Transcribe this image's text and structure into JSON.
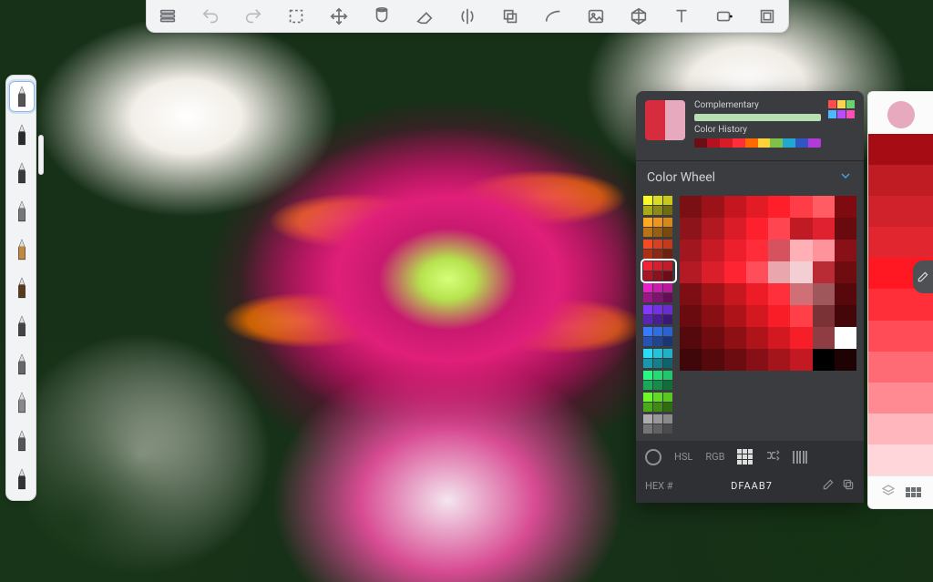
{
  "topbar": {
    "items": [
      {
        "name": "layers-icon",
        "interact": true
      },
      {
        "name": "undo-icon",
        "interact": true,
        "dim": true
      },
      {
        "name": "redo-icon",
        "interact": true,
        "dim": true
      },
      {
        "name": "selection-tool-icon",
        "interact": true
      },
      {
        "name": "transform-move-icon",
        "interact": true
      },
      {
        "name": "fill-bucket-icon",
        "interact": true
      },
      {
        "name": "eraser-icon",
        "interact": true
      },
      {
        "name": "symmetry-icon",
        "interact": true
      },
      {
        "name": "predictive-stroke-icon",
        "interact": true
      },
      {
        "name": "curve-ruler-icon",
        "interact": true
      },
      {
        "name": "import-image-icon",
        "interact": true
      },
      {
        "name": "perspective-grid-icon",
        "interact": true
      },
      {
        "name": "text-tool-icon",
        "interact": true
      },
      {
        "name": "timelapse-icon",
        "interact": true
      },
      {
        "name": "fullscreen-icon",
        "interact": true
      }
    ]
  },
  "left_tools": {
    "items": [
      {
        "name": "pencil-tool",
        "selected": true
      },
      {
        "name": "pen-tool"
      },
      {
        "name": "pen-fine-tool"
      },
      {
        "name": "marker-tool"
      },
      {
        "name": "brush-pen-tool"
      },
      {
        "name": "brush-broad-tool"
      },
      {
        "name": "airbrush-tool"
      },
      {
        "name": "smudge-tool"
      },
      {
        "name": "flat-brush-tool"
      },
      {
        "name": "chisel-tool"
      },
      {
        "name": "marker-chisel-tool"
      }
    ]
  },
  "color_panel": {
    "current_a": "#d72c3e",
    "current_b": "#e6a9bd",
    "complementary_label": "Complementary",
    "complementary_color": "#b7dfb1",
    "history_label": "Color History",
    "history": [
      "#6a0f15",
      "#b51220",
      "#d61c29",
      "#ff2e3b",
      "#ff6a00",
      "#ffd23a",
      "#7fc24b",
      "#22a7d0",
      "#3255c4",
      "#b13bd6"
    ],
    "mini": [
      [
        "#ff4d4d",
        "#ffd24d",
        "#6bd36b"
      ],
      [
        "#4db8ff",
        "#b84dff",
        "#ff4db8"
      ]
    ],
    "heading": "Color Wheel",
    "palette_groups": [
      {
        "base": "#c7c71f"
      },
      {
        "base": "#d8871a"
      },
      {
        "base": "#c63a1a"
      },
      {
        "base": "#c41a2a",
        "selected": true
      },
      {
        "base": "#b81a9e"
      },
      {
        "base": "#6a2bd1"
      },
      {
        "base": "#2b62d1"
      },
      {
        "base": "#1fb2c7"
      },
      {
        "base": "#1fc76a"
      },
      {
        "base": "#58c71f"
      },
      {
        "base": "#8a8a8a"
      }
    ],
    "big_grid": [
      "#7a0f14",
      "#9c1219",
      "#c4161f",
      "#e31b25",
      "#ff1f2a",
      "#ff3d46",
      "#ff5c64",
      "#7f0b10",
      "#8e141c",
      "#b11822",
      "#d91c28",
      "#ff202e",
      "#ff4550",
      "#c01b24",
      "#e02230",
      "#690a0e",
      "#a2161f",
      "#c81a26",
      "#ee1f2d",
      "#ff2c3a",
      "#d6525e",
      "#ffb0b6",
      "#ff939b",
      "#8a1017",
      "#b41a24",
      "#da1f2b",
      "#ff2432",
      "#ff4d59",
      "#e9a6ac",
      "#f3ced2",
      "#b92b35",
      "#6f0c10",
      "#7d0f14",
      "#9f1319",
      "#c7171f",
      "#ed1c26",
      "#ff303c",
      "#cf7076",
      "#a0575c",
      "#57080b",
      "#690b0f",
      "#8a0f14",
      "#ae131a",
      "#d41820",
      "#f81d27",
      "#ff4049",
      "#7a3236",
      "#440609",
      "#55090c",
      "#700c10",
      "#8e1015",
      "#af141b",
      "#d21922",
      "#f51e29",
      "#8f3d42",
      "#ffffff",
      "#40070a",
      "#55090c",
      "#6c0c10",
      "#861015",
      "#a3141b",
      "#c41822",
      "#000000",
      "#1e0304"
    ],
    "modes": {
      "hsl": "HSL",
      "rgb": "RGB"
    },
    "hex_label": "HEX #",
    "hex_value": "DFAAB7"
  },
  "right_sidebar": {
    "dot_color": "#e6a9bd",
    "stripes": [
      "#a60c14",
      "#c01c24",
      "#cf222b",
      "#e22630",
      "#ff1722",
      "#ff2f3a",
      "#ff4c56",
      "#ff6b74",
      "#ff8a92",
      "#ffb6bc",
      "#ffd6da"
    ]
  }
}
